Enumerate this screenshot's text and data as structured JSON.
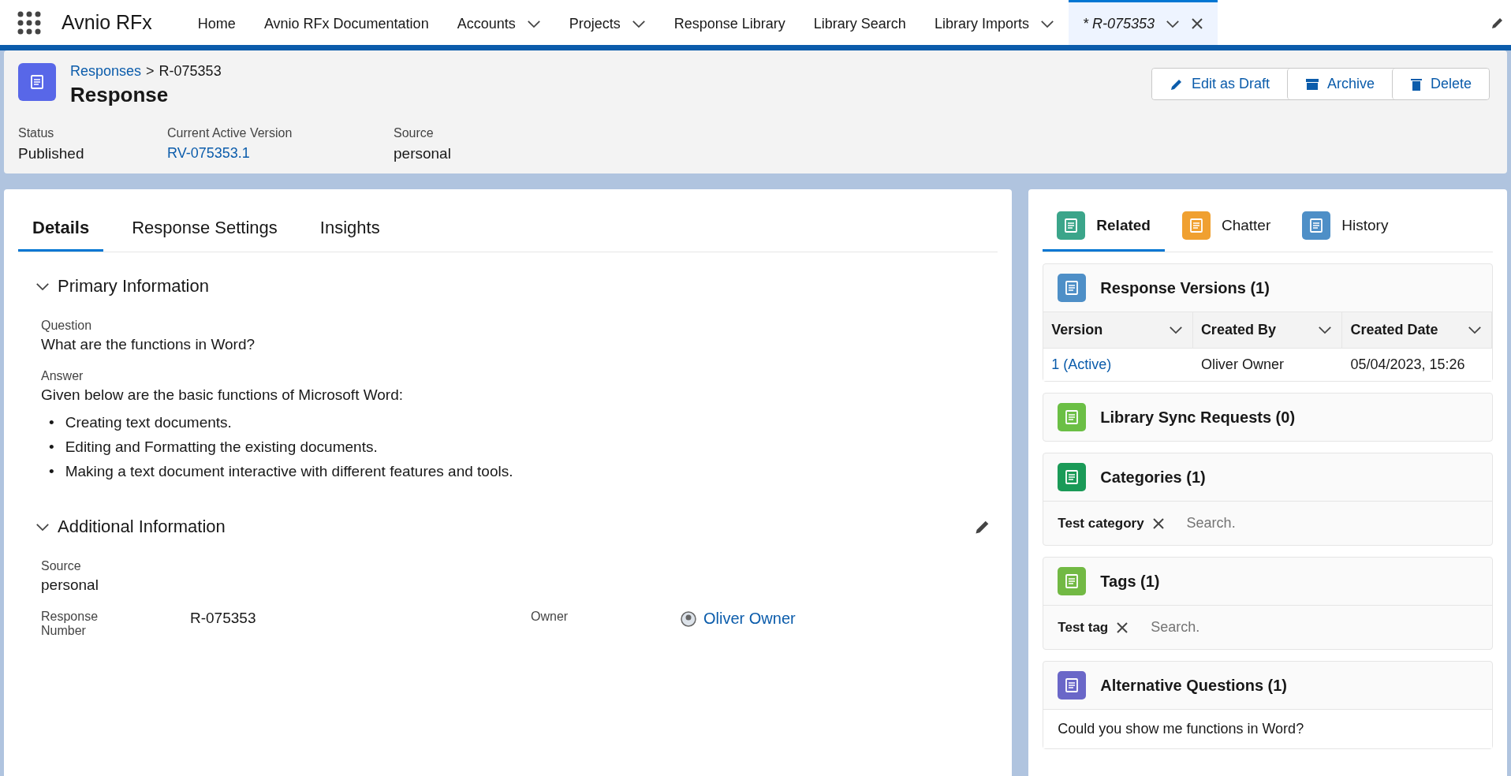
{
  "app_name": "Avnio RFx",
  "nav_items": [
    {
      "label": "Home",
      "has_menu": false,
      "selected": false
    },
    {
      "label": "Avnio RFx Documentation",
      "has_menu": false,
      "selected": false
    },
    {
      "label": "Accounts",
      "has_menu": true,
      "selected": false
    },
    {
      "label": "Projects",
      "has_menu": true,
      "selected": false
    },
    {
      "label": "Response Library",
      "has_menu": false,
      "selected": false
    },
    {
      "label": "Library Search",
      "has_menu": false,
      "selected": false
    },
    {
      "label": "Library Imports",
      "has_menu": true,
      "selected": false
    },
    {
      "label": "* R-075353",
      "has_menu": true,
      "selected": true,
      "closable": true
    }
  ],
  "header": {
    "breadcrumb_parent": "Responses",
    "breadcrumb_separator": ">",
    "breadcrumb_current": "R-075353",
    "title": "Response",
    "actions": [
      {
        "label": "Edit as Draft",
        "kind": "edit"
      },
      {
        "label": "Archive",
        "kind": "archive"
      },
      {
        "label": "Delete",
        "kind": "delete"
      }
    ],
    "fields": [
      {
        "label": "Status",
        "value": "Published",
        "link": false
      },
      {
        "label": "Current Active Version",
        "value": "RV-075353.1",
        "link": true
      },
      {
        "label": "Source",
        "value": "personal",
        "link": false
      }
    ]
  },
  "detail_tabs": [
    {
      "label": "Details",
      "selected": true
    },
    {
      "label": "Response Settings",
      "selected": false
    },
    {
      "label": "Insights",
      "selected": false
    }
  ],
  "primary": {
    "title": "Primary Information",
    "expanded": true,
    "question_label": "Question",
    "question": "What are the functions in Word?",
    "answer_label": "Answer",
    "answer_intro": "Given below are the basic functions of Microsoft Word:",
    "answer_bullet": "•",
    "answer_points": [
      "Creating text documents.",
      "Editing and Formatting the existing documents.",
      "Making a text document interactive with different features and tools."
    ]
  },
  "additional": {
    "title": "Additional Information",
    "expanded": true,
    "editable": true,
    "source_label": "Source",
    "source": "personal",
    "number_label": "Response Number",
    "number": "R-075353",
    "owner_label": "Owner",
    "owner": "Oliver Owner"
  },
  "related_tabs": [
    {
      "label": "Related",
      "selected": true,
      "color": "#3ba58a"
    },
    {
      "label": "Chatter",
      "selected": false,
      "color": "#f0a030"
    },
    {
      "label": "History",
      "selected": false,
      "color": "#4e8fc7"
    }
  ],
  "versions": {
    "title": "Response Versions (1)",
    "color": "#4e8fc7",
    "columns": [
      "Version",
      "Created By",
      "Created Date"
    ],
    "rows": [
      [
        "1 (Active)",
        "Oliver Owner",
        "05/04/2023, 15:26"
      ]
    ]
  },
  "sync": {
    "title": "Library Sync Requests (0)",
    "color": "#6bbf45"
  },
  "categories": {
    "title": "Categories (1)",
    "color": "#1a9a57",
    "pills": [
      "Test category"
    ],
    "placeholder": "Search."
  },
  "tags": {
    "title": "Tags (1)",
    "color": "#72b944",
    "pills": [
      "Test tag"
    ],
    "placeholder": "Search."
  },
  "alternatives": {
    "title": "Alternative Questions (1)",
    "color": "#6a67c8",
    "items": [
      "Could you show me functions in Word?"
    ]
  }
}
